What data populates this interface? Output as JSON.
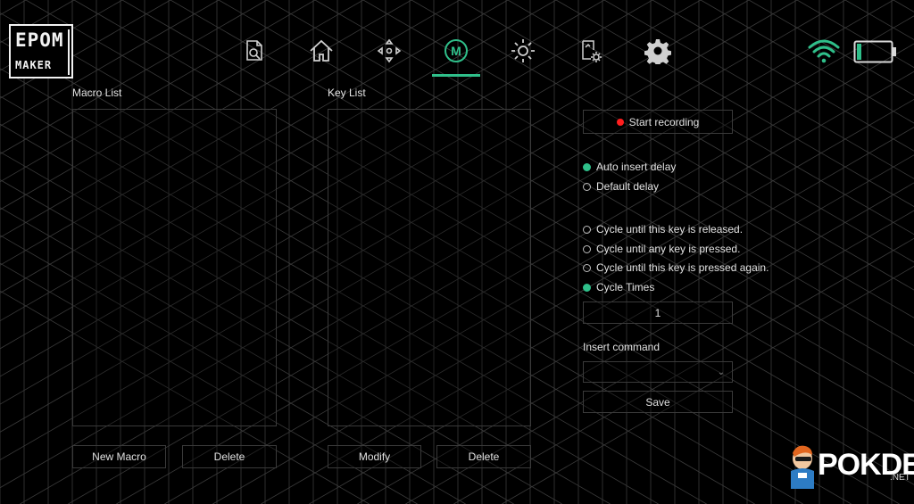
{
  "brand": {
    "logo_line1": "EPOM",
    "logo_line2": "MAKER"
  },
  "nav": {
    "items": [
      {
        "icon": "search-document-icon"
      },
      {
        "icon": "home-icon"
      },
      {
        "icon": "move-arrows-icon"
      },
      {
        "icon": "macro-icon",
        "label": "M",
        "active": true
      },
      {
        "icon": "brightness-icon"
      },
      {
        "icon": "device-settings-icon"
      },
      {
        "icon": "gear-icon"
      }
    ],
    "active_color": "#2fbf8a"
  },
  "status": {
    "wifi_icon": "wifi-icon",
    "battery_icon": "battery-icon",
    "battery_level": 0.12
  },
  "macro_list": {
    "title": "Macro List",
    "new_label": "New Macro",
    "delete_label": "Delete"
  },
  "key_list": {
    "title": "Key List",
    "modify_label": "Modify",
    "delete_label": "Delete"
  },
  "recording": {
    "start_label": "Start recording"
  },
  "delay_options": [
    {
      "label": "Auto insert delay",
      "selected": true
    },
    {
      "label": "Default delay",
      "selected": false
    }
  ],
  "cycle_options": [
    {
      "label": "Cycle until this key is released.",
      "selected": false
    },
    {
      "label": "Cycle until any key is pressed.",
      "selected": false
    },
    {
      "label": "Cycle until this key is pressed again.",
      "selected": false
    },
    {
      "label": "Cycle Times",
      "selected": true
    }
  ],
  "cycle_times_value": "1",
  "insert_command": {
    "label": "Insert command",
    "value": ""
  },
  "save_label": "Save",
  "watermark": {
    "text": "POKDE",
    "suffix": ".NET"
  }
}
